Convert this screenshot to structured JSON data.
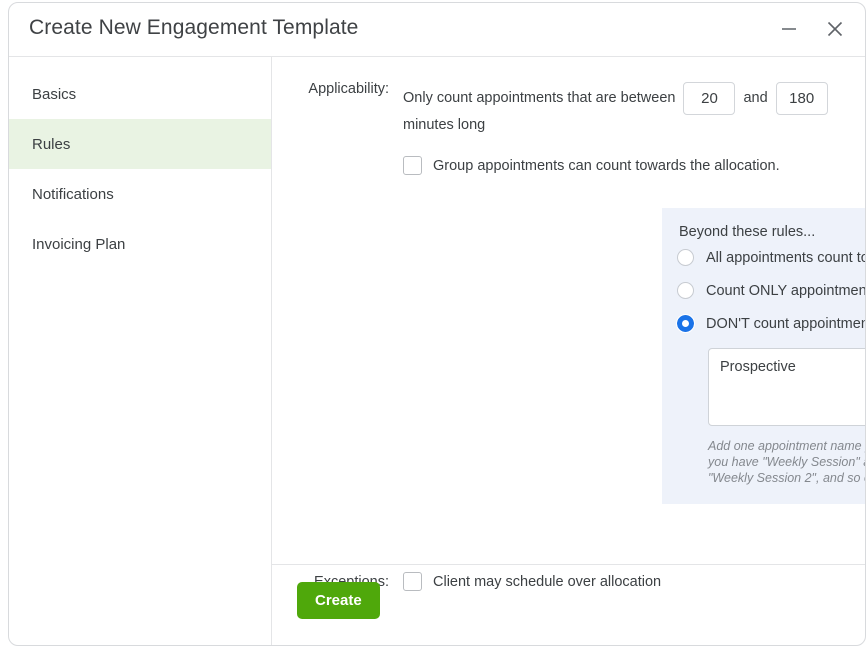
{
  "window": {
    "title": "Create New Engagement Template",
    "minimize_icon": "minimize-icon",
    "close_icon": "close-icon"
  },
  "sidebar": {
    "items": [
      {
        "label": "Basics",
        "active": false
      },
      {
        "label": "Rules",
        "active": true
      },
      {
        "label": "Notifications",
        "active": false
      },
      {
        "label": "Invoicing Plan",
        "active": false
      }
    ]
  },
  "main": {
    "applicability": {
      "label": "Applicability:",
      "text_before": "Only count appointments that are between",
      "min_value": "20",
      "and_word": "and",
      "max_value": "180",
      "text_after": "minutes long",
      "group_checkbox": {
        "label": "Group appointments can count towards the allocation.",
        "checked": false
      }
    },
    "rules_panel": {
      "title": "Beyond these rules...",
      "options": [
        {
          "label": "All appointments count towards the allocation.",
          "selected": false
        },
        {
          "label": "Count ONLY appointments with names like:",
          "selected": false
        },
        {
          "label": "DON'T count appointments with names like:",
          "selected": true
        }
      ],
      "names_textarea_value": "Prospective",
      "names_textarea_placeholder": "",
      "hint": "Add one appointment name per line. Partials will be matches, so if you have \"Weekly Session\" as an item, \"Weekly Session 1\", \"Weekly Session 2\", and so on will all be skipped."
    },
    "exceptions": {
      "label": "Exceptions:",
      "checkbox": {
        "label": "Client may schedule over allocation",
        "checked": false
      }
    }
  },
  "footer": {
    "create_label": "Create"
  },
  "colors": {
    "accent_green": "#4fa80b",
    "sidebar_active": "#e9f3e3",
    "panel_bg": "#eef2fa",
    "radio_selected": "#1a73e8"
  }
}
